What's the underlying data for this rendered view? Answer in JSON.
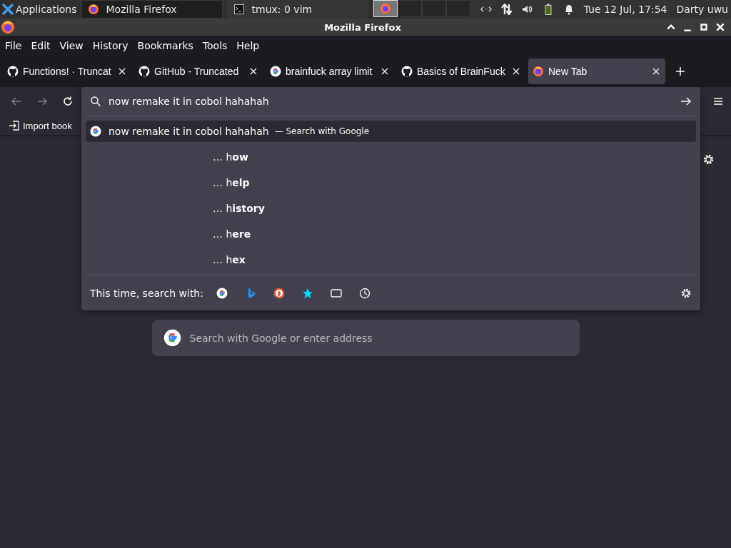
{
  "panel": {
    "apps_label": "Applications",
    "windows": [
      {
        "title": "Mozilla Firefox",
        "kind": "firefox",
        "selected": true
      },
      {
        "title": "tmux: 0 vim",
        "kind": "terminal",
        "selected": false
      }
    ],
    "workspaces": [
      {
        "selected": true,
        "has_window": true
      },
      {
        "selected": false,
        "has_window": false
      },
      {
        "selected": false,
        "has_window": false
      },
      {
        "selected": false,
        "has_window": false
      }
    ],
    "clock": "Tue 12 Jul, 17:54",
    "user": "Darty uwu"
  },
  "window": {
    "title": "Mozilla Firefox"
  },
  "menu": [
    "File",
    "Edit",
    "View",
    "History",
    "Bookmarks",
    "Tools",
    "Help"
  ],
  "tabs": [
    {
      "title": "Functions! · Truncat",
      "kind": "github",
      "selected": false
    },
    {
      "title": "GitHub - Truncated",
      "kind": "github",
      "selected": false
    },
    {
      "title": "brainfuck array limit",
      "kind": "google",
      "selected": false
    },
    {
      "title": "Basics of BrainFuck",
      "kind": "github",
      "selected": false
    },
    {
      "title": "New Tab",
      "kind": "firefox",
      "selected": true
    }
  ],
  "nav": {
    "back_disabled": true,
    "forward_disabled": true
  },
  "bookmarks": [
    {
      "label": "Import book"
    }
  ],
  "urlbar": {
    "value": "now remake it in cobol hahahah",
    "results": [
      {
        "kind": "search",
        "text": "now remake it in cobol hahahah",
        "action": "— Search with Google",
        "selected": true
      },
      {
        "kind": "suggestion",
        "text": "… h**ow**",
        "selected": false
      },
      {
        "kind": "suggestion",
        "text": "… h**elp**",
        "selected": false
      },
      {
        "kind": "suggestion",
        "text": "… h**istory**",
        "selected": false
      },
      {
        "kind": "suggestion",
        "text": "… h**ere**",
        "selected": false
      },
      {
        "kind": "suggestion",
        "text": "… h**ex**",
        "selected": false
      }
    ],
    "footer_label": "This time, search with:"
  },
  "newtab": {
    "search_placeholder": "Search with Google or enter address"
  }
}
